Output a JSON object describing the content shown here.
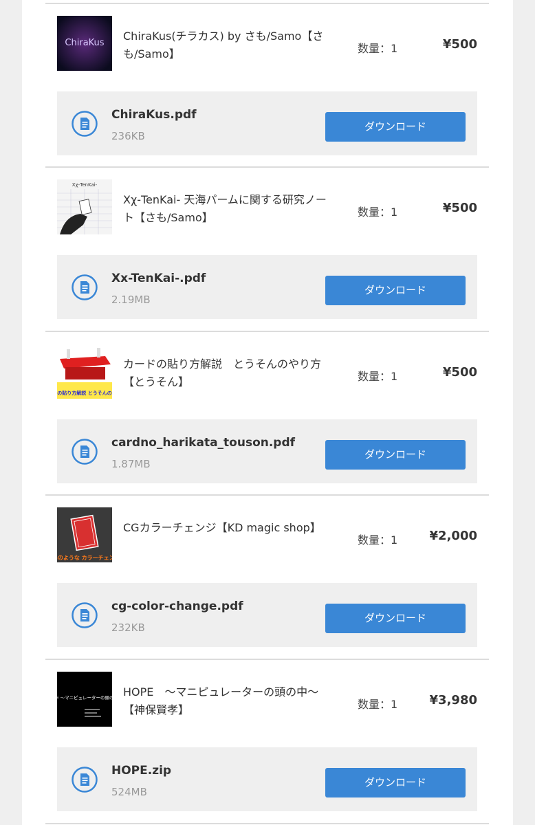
{
  "colors": {
    "accent": "#3a87d6",
    "download_box_bg": "#efefef",
    "border": "#dcdcdc"
  },
  "orders": [
    {
      "product_title": "ChiraKus(チラカス) by さも/Samo【さも/Samo】",
      "quantity_label": "数量：1",
      "price": "¥500",
      "thumbnail_text": "ChiraKus",
      "file_icon": "document-icon",
      "file_name": "ChiraKus.pdf",
      "file_size": "236KB",
      "download_label": "ダウンロード"
    },
    {
      "product_title": "Xχ-TenKai- 天海パームに関する研究ノート【さも/Samo】",
      "quantity_label": "数量：1",
      "price": "¥500",
      "thumbnail_text": "Xχ-TenKai-",
      "file_icon": "document-icon",
      "file_name": "Xx-TenKai-.pdf",
      "file_size": "2.19MB",
      "download_label": "ダウンロード"
    },
    {
      "product_title": "カードの貼り方解説　とうそんのやり方【とうそん】",
      "quantity_label": "数量：1",
      "price": "¥500",
      "thumbnail_text": "カードの貼り方解説 とうそんのやり方",
      "file_icon": "document-icon",
      "file_name": "cardno_harikata_touson.pdf",
      "file_size": "1.87MB",
      "download_label": "ダウンロード"
    },
    {
      "product_title": "CGカラーチェンジ【KD magic shop】",
      "quantity_label": "数量：1",
      "price": "¥2,000",
      "thumbnail_text": "CGのような カラーチェンジ",
      "file_icon": "document-icon",
      "file_name": "cg-color-change.pdf",
      "file_size": "232KB",
      "download_label": "ダウンロード"
    },
    {
      "product_title": "HOPE　〜マニピュレーターの頭の中〜【神保賢孝】",
      "quantity_label": "数量：1",
      "price": "¥3,980",
      "thumbnail_text": "HOPE 〜マニピュレーターの頭の中〜",
      "file_icon": "document-icon",
      "file_name": "HOPE.zip",
      "file_size": "524MB",
      "download_label": "ダウンロード"
    }
  ]
}
